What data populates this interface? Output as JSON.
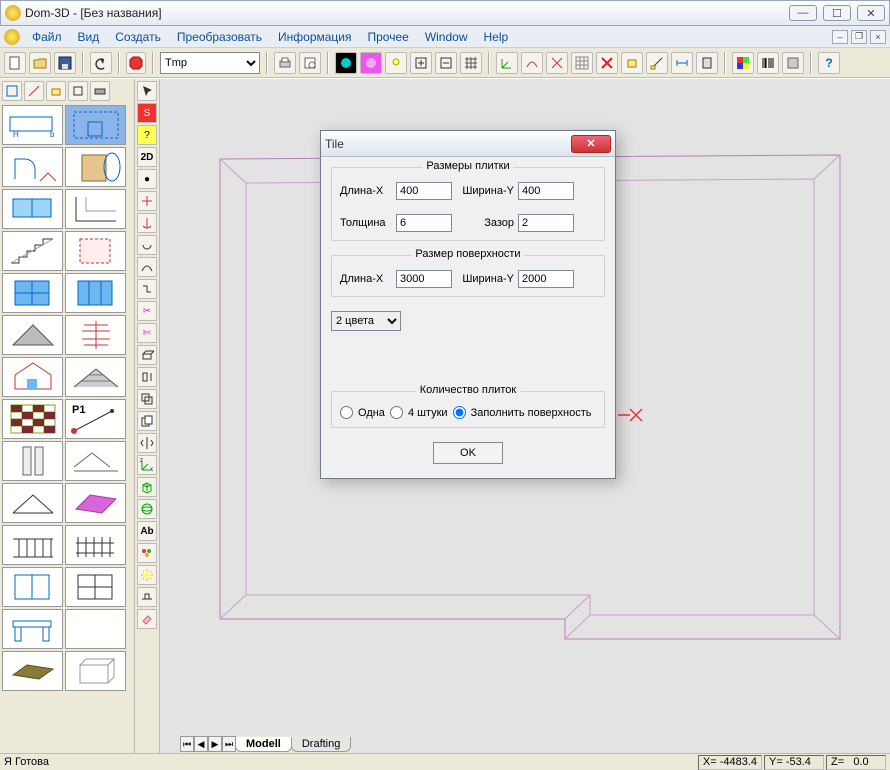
{
  "window": {
    "title": "Dom-3D - [Без названия]"
  },
  "menu": {
    "items": [
      "Файл",
      "Вид",
      "Создать",
      "Преобразовать",
      "Информация",
      "Прочее",
      "Window",
      "Help"
    ]
  },
  "toolbar": {
    "combo": "Tmp",
    "help_icon": "?"
  },
  "tabs": {
    "active": "Modell",
    "inactive": "Drafting"
  },
  "status": {
    "left": "Я Готова",
    "x_label": "X=",
    "x_value": "-4483.4",
    "y_label": "Y=",
    "y_value": "-53.4",
    "z_label": "Z=",
    "z_value": "0.0"
  },
  "dialog": {
    "title": "Tile",
    "group_tile_size": "Размеры плитки",
    "label_length_x": "Длина-X",
    "value_length_x": "400",
    "label_width_y": "Ширина-Y",
    "value_width_y": "400",
    "label_thickness": "Толщина",
    "value_thickness": "6",
    "label_gap": "Зазор",
    "value_gap": "2",
    "group_surf_size": "Размер поверхности",
    "label_surf_length": "Длина-X",
    "value_surf_length": "3000",
    "label_surf_width": "Ширина-Y",
    "value_surf_width": "2000",
    "color_select": "2 цвета",
    "group_count": "Количество плиток",
    "radio_one": "Одна",
    "radio_four": "4 штуки",
    "radio_fill": "Заполнить поверхность",
    "ok": "OK"
  },
  "palette": {
    "2d_label": "2D",
    "ab_label": "Ab",
    "p1_label": "P1"
  }
}
